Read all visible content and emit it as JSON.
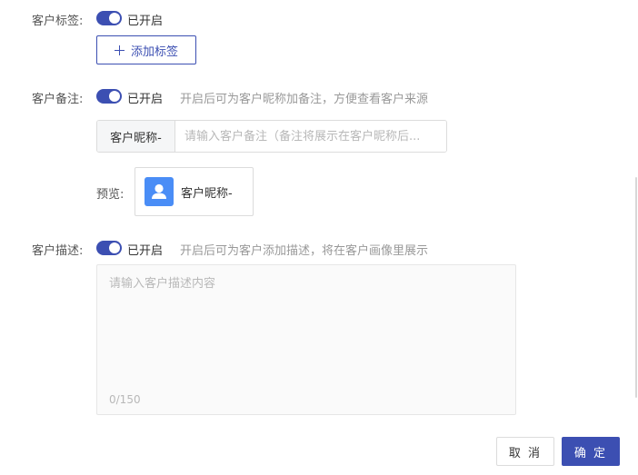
{
  "tags": {
    "label": "客户标签:",
    "status": "已开启",
    "add_button": "添加标签"
  },
  "remark": {
    "label": "客户备注:",
    "status": "已开启",
    "hint": "开启后可为客户昵称加备注，方便查看客户来源",
    "addon": "客户昵称-",
    "placeholder": "请输入客户备注（备注将展示在客户昵称后...",
    "preview_label": "预览:",
    "preview_name": "客户昵称-"
  },
  "description": {
    "label": "客户描述:",
    "status": "已开启",
    "hint": "开启后可为客户添加描述，将在客户画像里展示",
    "placeholder": "请输入客户描述内容",
    "counter": "0/150"
  },
  "footer": {
    "cancel": "取 消",
    "confirm": "确 定"
  },
  "colors": {
    "accent": "#3c4fb2",
    "avatar": "#4a8df6"
  },
  "icons": {
    "add": "plus-icon",
    "avatar": "user-avatar-icon"
  }
}
